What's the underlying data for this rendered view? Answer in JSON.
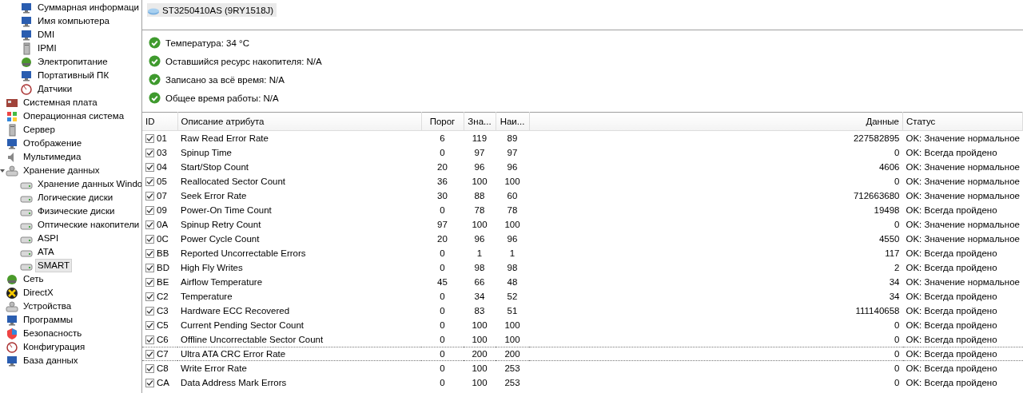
{
  "sidebar": {
    "continued_children": [
      {
        "label": "Суммарная информаци",
        "selected": false
      },
      {
        "label": "Имя компьютера",
        "selected": false
      },
      {
        "label": "DMI",
        "selected": false
      },
      {
        "label": "IPMI",
        "selected": false
      },
      {
        "label": "Электропитание",
        "selected": false
      },
      {
        "label": "Портативный ПК",
        "selected": false
      },
      {
        "label": "Датчики",
        "selected": false
      }
    ],
    "items": [
      {
        "label": "Системная плата",
        "selected": false
      },
      {
        "label": "Операционная система",
        "selected": false
      },
      {
        "label": "Сервер",
        "selected": false
      },
      {
        "label": "Отображение",
        "selected": false
      },
      {
        "label": "Мультимедиа",
        "selected": false
      },
      {
        "label": "Хранение данных",
        "selected": false,
        "expanded": true,
        "children": [
          {
            "label": "Хранение данных Windo",
            "selected": false
          },
          {
            "label": "Логические диски",
            "selected": false
          },
          {
            "label": "Физические диски",
            "selected": false
          },
          {
            "label": "Оптические накопители",
            "selected": false
          },
          {
            "label": "ASPI",
            "selected": false
          },
          {
            "label": "ATA",
            "selected": false
          },
          {
            "label": "SMART",
            "selected": true
          }
        ]
      },
      {
        "label": "Сеть",
        "selected": false
      },
      {
        "label": "DirectX",
        "selected": false
      },
      {
        "label": "Устройства",
        "selected": false
      },
      {
        "label": "Программы",
        "selected": false
      },
      {
        "label": "Безопасность",
        "selected": false
      },
      {
        "label": "Конфигурация",
        "selected": false
      },
      {
        "label": "База данных",
        "selected": false
      }
    ]
  },
  "devices": [
    {
      "label": "ST3250410AS (9RY1518J)",
      "selected": true
    }
  ],
  "summary": [
    {
      "text": "Температура: 34 °C"
    },
    {
      "text": "Оставшийся ресурс накопителя: N/A"
    },
    {
      "text": "Записано за всё время: N/A"
    },
    {
      "text": "Общее время работы: N/A"
    }
  ],
  "table": {
    "columns": [
      "ID",
      "Описание атрибута",
      "Порог",
      "Зна...",
      "Наи...",
      "Данные",
      "Статус"
    ],
    "rows": [
      {
        "checked": true,
        "selected": false,
        "id": "01",
        "name": "Raw Read Error Rate",
        "threshold": "6",
        "value": "119",
        "worst": "89",
        "data": "227582895",
        "status": "OK: Значение нормальное"
      },
      {
        "checked": true,
        "selected": false,
        "id": "03",
        "name": "Spinup Time",
        "threshold": "0",
        "value": "97",
        "worst": "97",
        "data": "0",
        "status": "OK: Всегда пройдено"
      },
      {
        "checked": true,
        "selected": false,
        "id": "04",
        "name": "Start/Stop Count",
        "threshold": "20",
        "value": "96",
        "worst": "96",
        "data": "4606",
        "status": "OK: Значение нормальное"
      },
      {
        "checked": true,
        "selected": false,
        "id": "05",
        "name": "Reallocated Sector Count",
        "threshold": "36",
        "value": "100",
        "worst": "100",
        "data": "0",
        "status": "OK: Значение нормальное"
      },
      {
        "checked": true,
        "selected": false,
        "id": "07",
        "name": "Seek Error Rate",
        "threshold": "30",
        "value": "88",
        "worst": "60",
        "data": "712663680",
        "status": "OK: Значение нормальное"
      },
      {
        "checked": true,
        "selected": false,
        "id": "09",
        "name": "Power-On Time Count",
        "threshold": "0",
        "value": "78",
        "worst": "78",
        "data": "19498",
        "status": "OK: Всегда пройдено"
      },
      {
        "checked": true,
        "selected": false,
        "id": "0A",
        "name": "Spinup Retry Count",
        "threshold": "97",
        "value": "100",
        "worst": "100",
        "data": "0",
        "status": "OK: Значение нормальное"
      },
      {
        "checked": true,
        "selected": false,
        "id": "0C",
        "name": "Power Cycle Count",
        "threshold": "20",
        "value": "96",
        "worst": "96",
        "data": "4550",
        "status": "OK: Значение нормальное"
      },
      {
        "checked": true,
        "selected": false,
        "id": "BB",
        "name": "Reported Uncorrectable Errors",
        "threshold": "0",
        "value": "1",
        "worst": "1",
        "data": "117",
        "status": "OK: Всегда пройдено"
      },
      {
        "checked": true,
        "selected": false,
        "id": "BD",
        "name": "High Fly Writes",
        "threshold": "0",
        "value": "98",
        "worst": "98",
        "data": "2",
        "status": "OK: Всегда пройдено"
      },
      {
        "checked": true,
        "selected": false,
        "id": "BE",
        "name": "Airflow Temperature",
        "threshold": "45",
        "value": "66",
        "worst": "48",
        "data": "34",
        "status": "OK: Значение нормальное"
      },
      {
        "checked": true,
        "selected": false,
        "id": "C2",
        "name": "Temperature",
        "threshold": "0",
        "value": "34",
        "worst": "52",
        "data": "34",
        "status": "OK: Всегда пройдено"
      },
      {
        "checked": true,
        "selected": false,
        "id": "C3",
        "name": "Hardware ECC Recovered",
        "threshold": "0",
        "value": "83",
        "worst": "51",
        "data": "111140658",
        "status": "OK: Всегда пройдено"
      },
      {
        "checked": true,
        "selected": false,
        "id": "C5",
        "name": "Current Pending Sector Count",
        "threshold": "0",
        "value": "100",
        "worst": "100",
        "data": "0",
        "status": "OK: Всегда пройдено"
      },
      {
        "checked": true,
        "selected": false,
        "id": "C6",
        "name": "Offline Uncorrectable Sector Count",
        "threshold": "0",
        "value": "100",
        "worst": "100",
        "data": "0",
        "status": "OK: Всегда пройдено"
      },
      {
        "checked": true,
        "selected": true,
        "id": "C7",
        "name": "Ultra ATA CRC Error Rate",
        "threshold": "0",
        "value": "200",
        "worst": "200",
        "data": "0",
        "status": "OK: Всегда пройдено"
      },
      {
        "checked": true,
        "selected": false,
        "id": "C8",
        "name": "Write Error Rate",
        "threshold": "0",
        "value": "100",
        "worst": "253",
        "data": "0",
        "status": "OK: Всегда пройдено"
      },
      {
        "checked": true,
        "selected": false,
        "id": "CA",
        "name": "Data Address Mark Errors",
        "threshold": "0",
        "value": "100",
        "worst": "253",
        "data": "0",
        "status": "OK: Всегда пройдено"
      }
    ]
  }
}
